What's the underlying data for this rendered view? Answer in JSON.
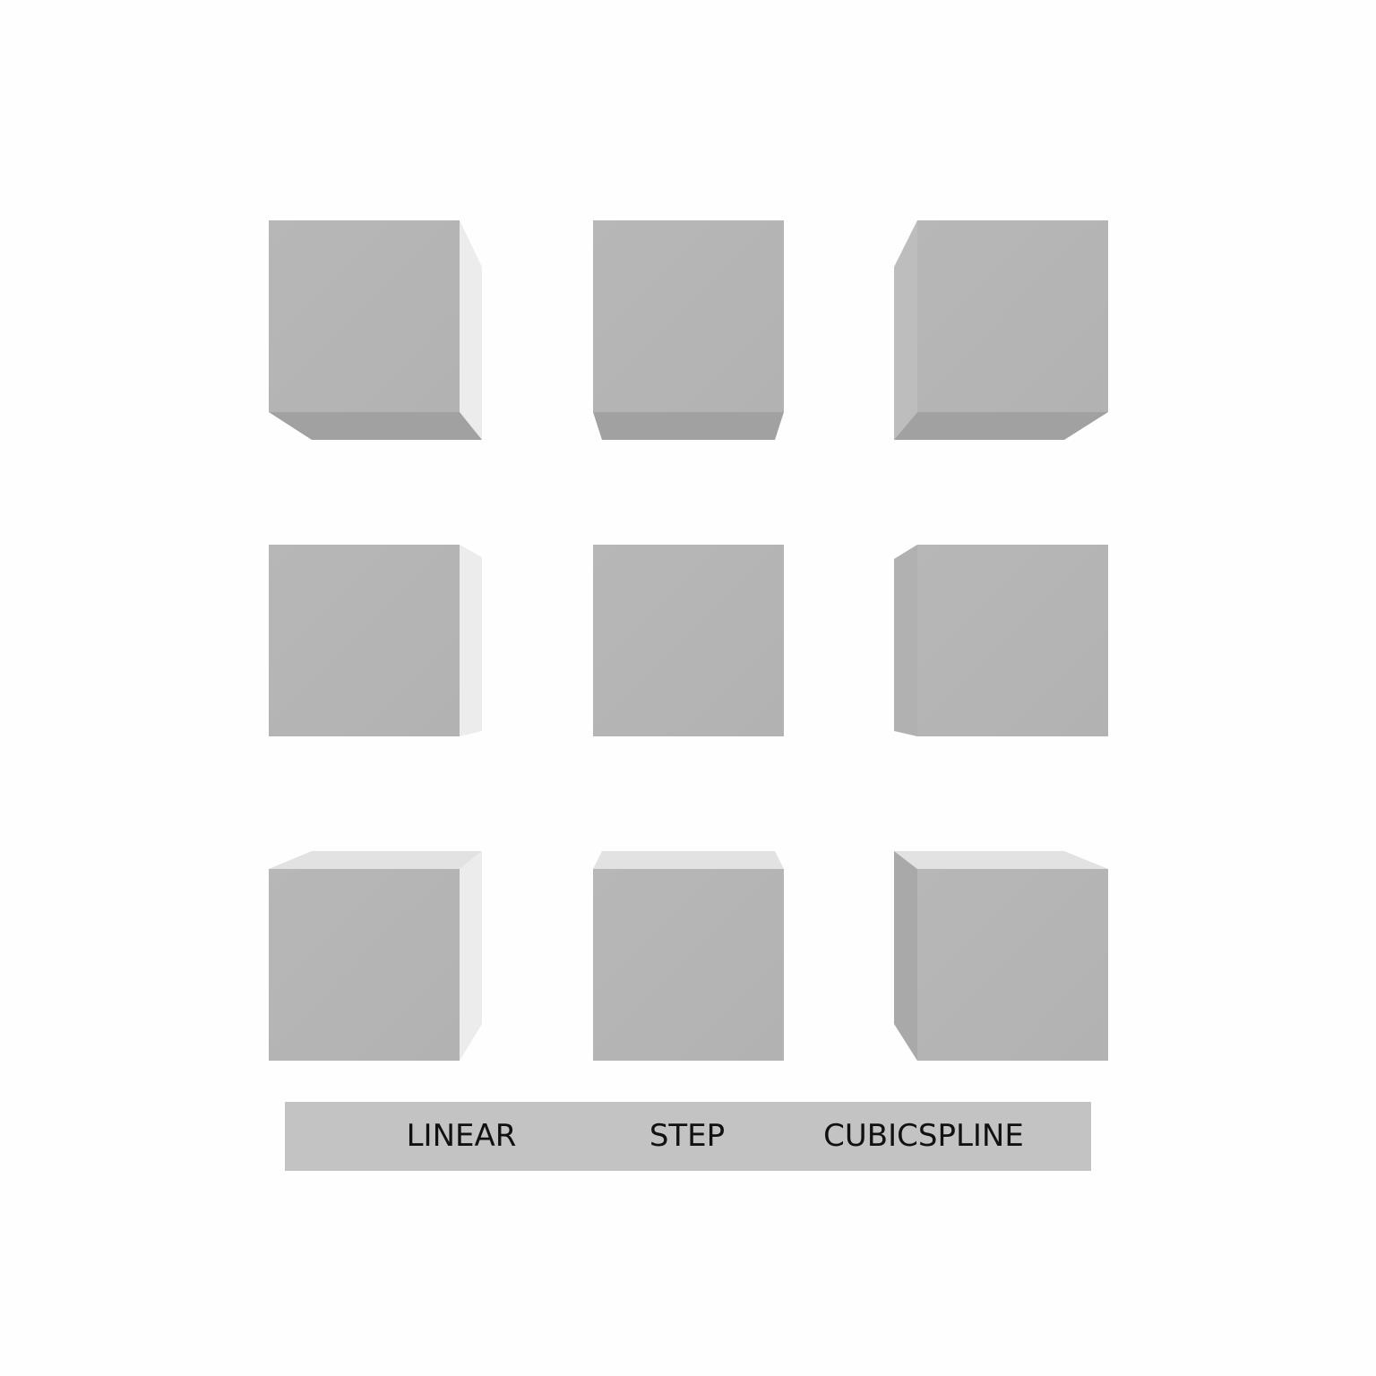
{
  "colors": {
    "background": "#fefefe",
    "cube_front": "#b4b4b4",
    "cube_bottom": "#a1a1a1",
    "cube_top": "#e2e2e2",
    "cube_side_light": "#ececec",
    "cube_side_mid": "#bdbdbd",
    "cube_side_dark": "#a9a9a9",
    "label_bar": "#c3c3c3",
    "label_text": "#111111"
  },
  "cube_grid": {
    "rows": 3,
    "columns": 3
  },
  "labels": {
    "linear": "LINEAR",
    "step": "STEP",
    "cubicspline": "CUBICSPLINE"
  }
}
